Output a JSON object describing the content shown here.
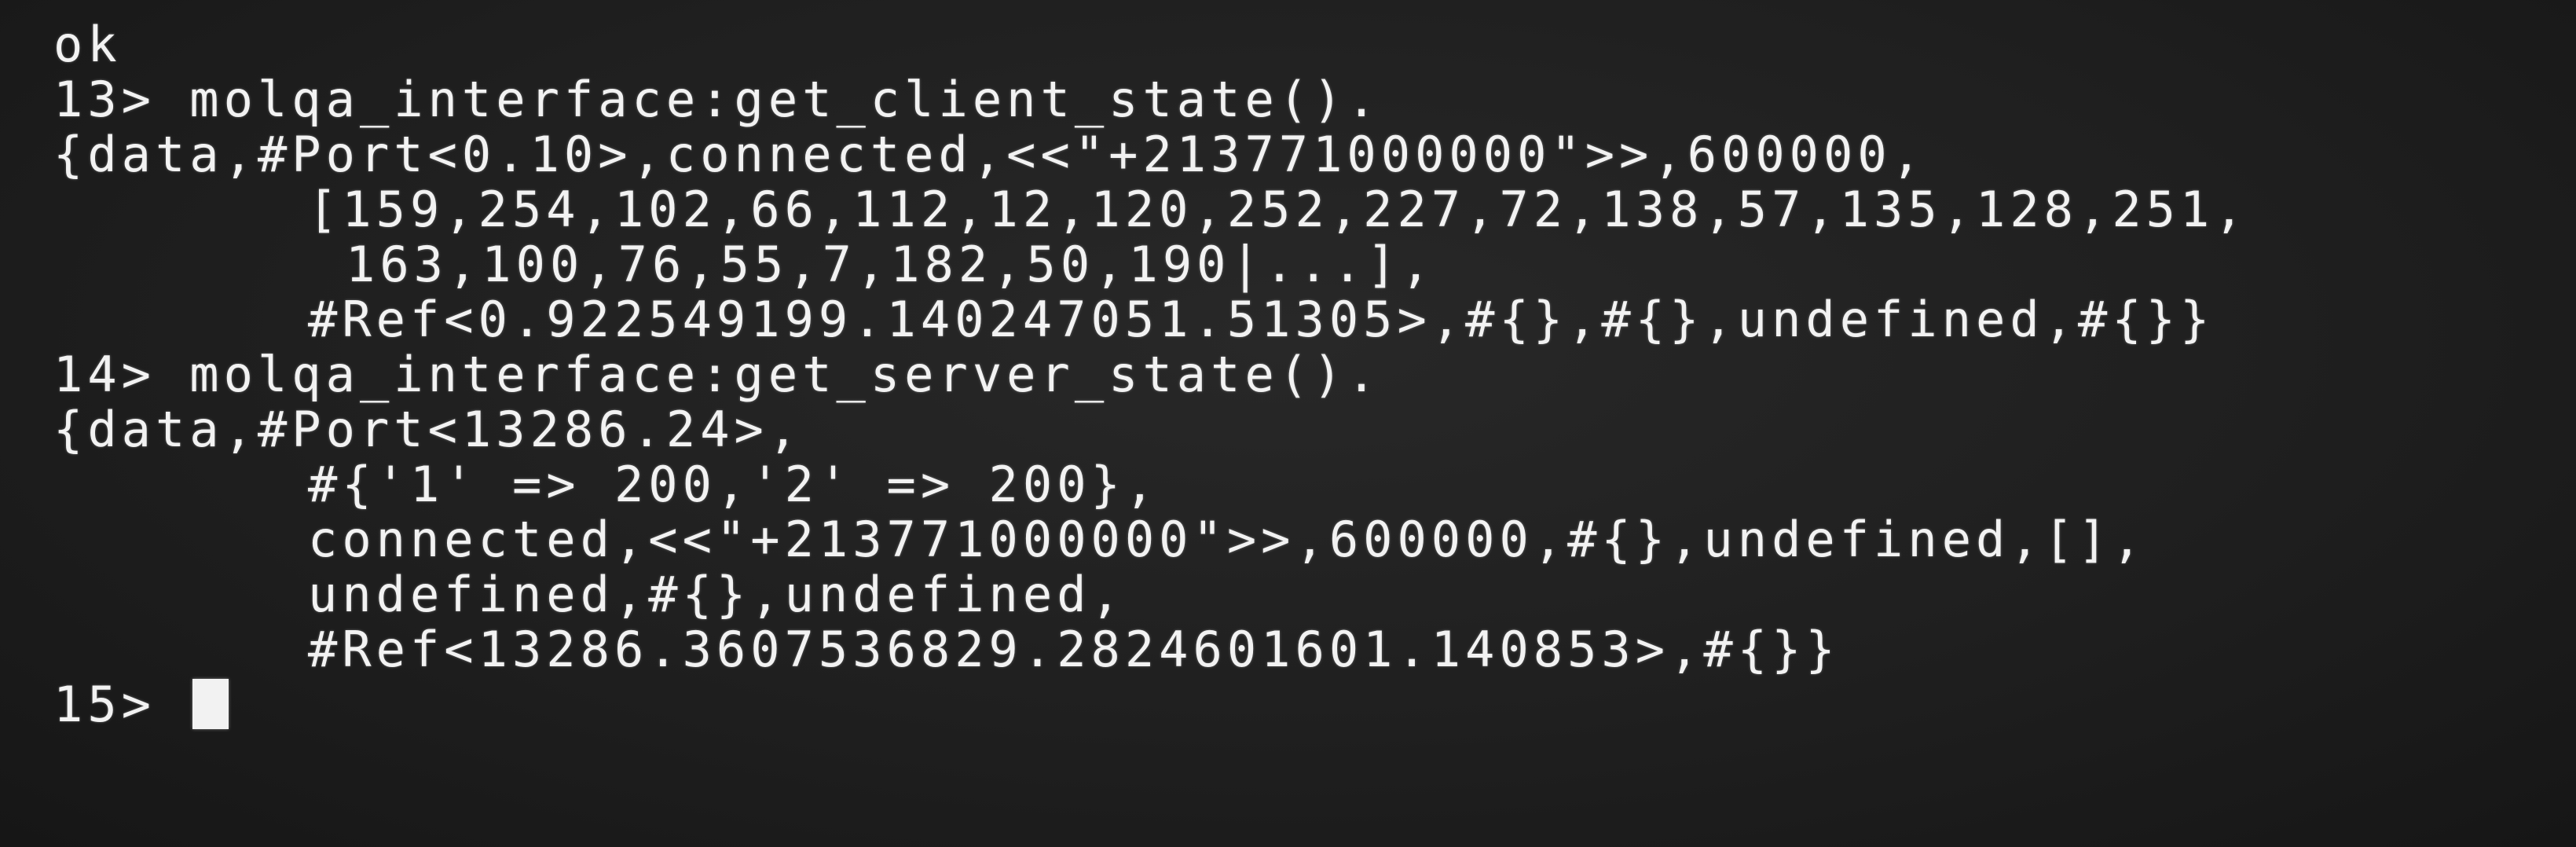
{
  "terminal": {
    "lines": [
      {
        "text": "ok",
        "indent": 0
      },
      {
        "text": "13> molqa_interface:get_client_state().",
        "indent": 0
      },
      {
        "text": "{data,#Port<0.10>,connected,<<\"+213771000000\">>,600000,",
        "indent": 0
      },
      {
        "text": "[159,254,102,66,112,12,120,252,227,72,138,57,135,128,251,",
        "indent": 1
      },
      {
        "text": "163,100,76,55,7,182,50,190|...],",
        "indent": 2
      },
      {
        "text": "#Ref<0.922549199.140247051.51305>,#{},#{},undefined,#{}}",
        "indent": 1
      },
      {
        "text": "14> molqa_interface:get_server_state().",
        "indent": 0
      },
      {
        "text": "{data,#Port<13286.24>,",
        "indent": 0
      },
      {
        "text": "#{'1' => 200,'2' => 200},",
        "indent": 1
      },
      {
        "text": "connected,<<\"+213771000000\">>,600000,#{},undefined,[],",
        "indent": 1
      },
      {
        "text": "undefined,#{},undefined,",
        "indent": 1
      },
      {
        "text": "#Ref<13286.3607536829.2824601601.140853>,#{}}",
        "indent": 1
      }
    ],
    "prompt": "15> "
  },
  "colors": {
    "background": "#1f1f1f",
    "text": "#f2f2f2"
  }
}
